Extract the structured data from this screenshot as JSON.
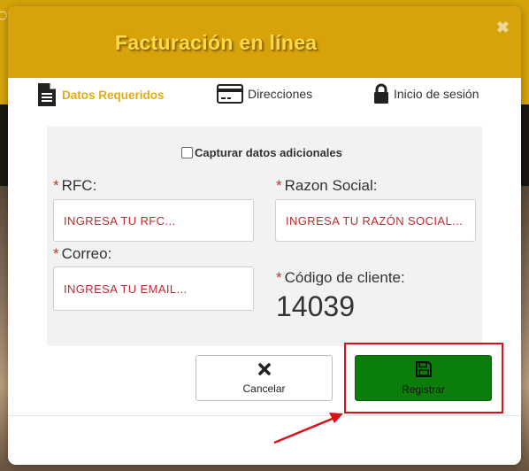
{
  "modal": {
    "title": "Facturación en línea",
    "close_glyph": "✖"
  },
  "tabs": [
    {
      "label": "Datos Requeridos",
      "icon": "document-icon",
      "active": true
    },
    {
      "label": "Direcciones",
      "icon": "credit-card-icon",
      "active": false
    },
    {
      "label": "Inicio de sesión",
      "icon": "lock-icon",
      "active": false
    }
  ],
  "form": {
    "capture_extra_label": "Capturar datos adicionales",
    "required_mark": "*",
    "rfc": {
      "label": "RFC:",
      "placeholder": "INGRESA TU RFC..."
    },
    "razon_social": {
      "label": "Razon Social:",
      "placeholder": "INGRESA TU RAZÓN SOCIAL..."
    },
    "correo": {
      "label": "Correo:",
      "placeholder": "INGRESA TU EMAIL..."
    },
    "codigo_cliente": {
      "label": "Código de cliente:",
      "value": "14039"
    }
  },
  "buttons": {
    "cancel_label": "Cancelar",
    "cancel_icon": "x-icon",
    "register_label": "Registrar",
    "register_icon": "floppy-disk-icon"
  },
  "colors": {
    "header": "#d7a20a",
    "title": "#ffd84a",
    "active_tab": "#e0ad12",
    "required": "#c0392b",
    "placeholder": "#c0282d",
    "register_button": "#0a7d0a",
    "annotation": "#d8101a"
  }
}
